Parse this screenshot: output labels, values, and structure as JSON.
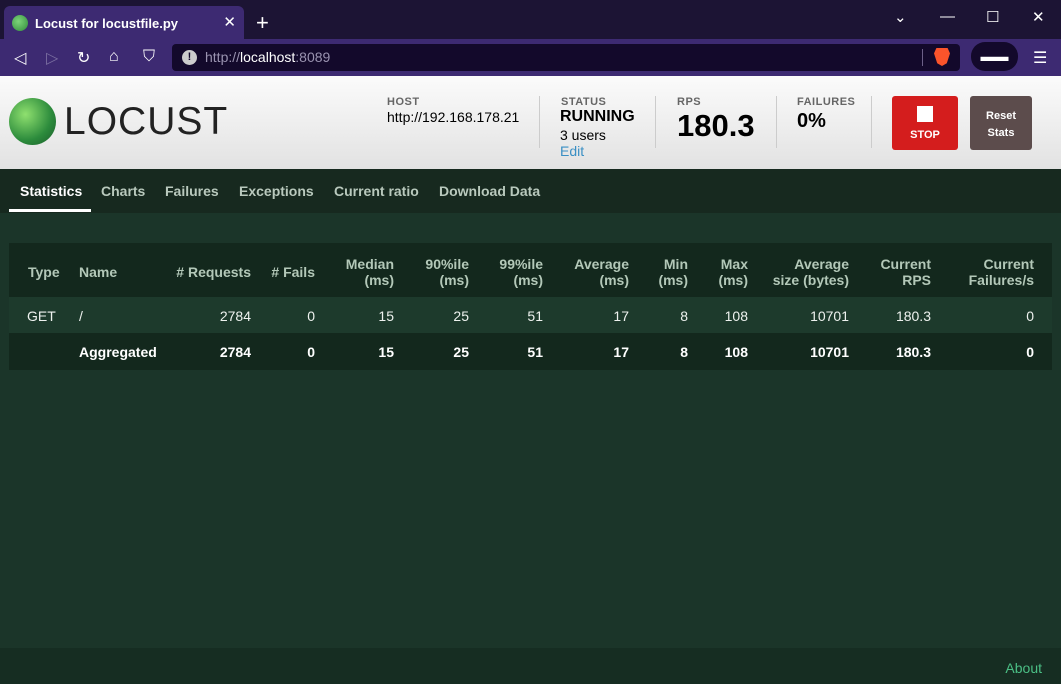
{
  "browser": {
    "tab_title": "Locust for locustfile.py",
    "url_scheme": "http://",
    "url_host": "localhost",
    "url_port": ":8089",
    "icons": [
      "back-icon",
      "forward-icon",
      "reload-icon",
      "home-icon",
      "bookmark-icon",
      "info-icon",
      "brave-shield-icon",
      "private-glasses-icon",
      "menu-icon"
    ]
  },
  "header": {
    "logo_text": "LOCUST",
    "host_label": "HOST",
    "host_value": "http://192.168.178.21",
    "status_label": "STATUS",
    "status_value": "RUNNING",
    "users_value": "3 users",
    "edit_label": "Edit",
    "rps_label": "RPS",
    "rps_value": "180.3",
    "failures_label": "FAILURES",
    "failures_value": "0%",
    "stop_label": "STOP",
    "reset_label_line1": "Reset",
    "reset_label_line2": "Stats"
  },
  "tabs": [
    "Statistics",
    "Charts",
    "Failures",
    "Exceptions",
    "Current ratio",
    "Download Data"
  ],
  "table": {
    "headers": {
      "type": "Type",
      "name": "Name",
      "requests": "# Requests",
      "fails": "# Fails",
      "median_1": "Median",
      "median_2": "(ms)",
      "p90_1": "90%ile",
      "p90_2": "(ms)",
      "p99_1": "99%ile",
      "p99_2": "(ms)",
      "avg_1": "Average",
      "avg_2": "(ms)",
      "min_1": "Min",
      "min_2": "(ms)",
      "max_1": "Max",
      "max_2": "(ms)",
      "size_1": "Average",
      "size_2": "size (bytes)",
      "rps_1": "Current",
      "rps_2": "RPS",
      "fps_1": "Current",
      "fps_2": "Failures/s"
    },
    "rows": [
      {
        "type": "GET",
        "name": "/",
        "requests": "2784",
        "fails": "0",
        "median": "15",
        "p90": "25",
        "p99": "51",
        "avg": "17",
        "min": "8",
        "max": "108",
        "size": "10701",
        "rps": "180.3",
        "fps": "0"
      },
      {
        "type": "",
        "name": "Aggregated",
        "requests": "2784",
        "fails": "0",
        "median": "15",
        "p90": "25",
        "p99": "51",
        "avg": "17",
        "min": "8",
        "max": "108",
        "size": "10701",
        "rps": "180.3",
        "fps": "0"
      }
    ]
  },
  "footer": {
    "about_label": "About"
  },
  "colors": {
    "accent_green": "#4bbf85",
    "stop_red": "#d41d1d",
    "background": "#1b3529"
  }
}
